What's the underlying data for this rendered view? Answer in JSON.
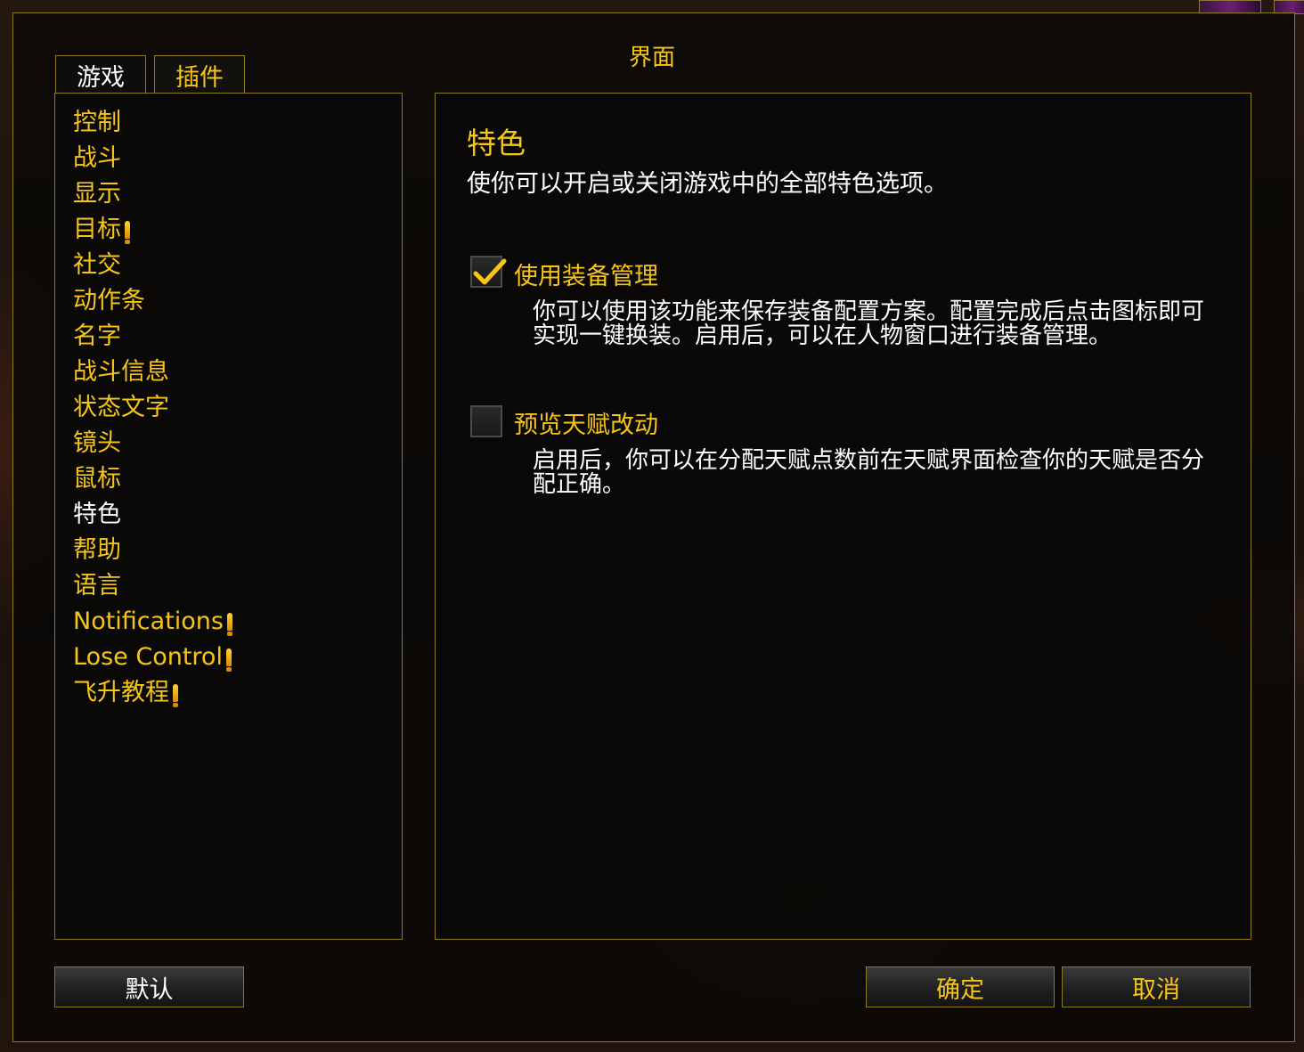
{
  "window": {
    "title": "界面"
  },
  "tabs": [
    {
      "label": "游戏",
      "active": true
    },
    {
      "label": "插件",
      "active": false
    }
  ],
  "categories": [
    {
      "label": "控制",
      "alert": false
    },
    {
      "label": "战斗",
      "alert": false
    },
    {
      "label": "显示",
      "alert": false
    },
    {
      "label": "目标",
      "alert": true
    },
    {
      "label": "社交",
      "alert": false
    },
    {
      "label": "动作条",
      "alert": false
    },
    {
      "label": "名字",
      "alert": false
    },
    {
      "label": "战斗信息",
      "alert": false
    },
    {
      "label": "状态文字",
      "alert": false
    },
    {
      "label": "镜头",
      "alert": false
    },
    {
      "label": "鼠标",
      "alert": false
    },
    {
      "label": "特色",
      "alert": false,
      "selected": true
    },
    {
      "label": "帮助",
      "alert": false
    },
    {
      "label": "语言",
      "alert": false
    },
    {
      "label": "Notifications",
      "alert": true
    },
    {
      "label": "Lose Control",
      "alert": true
    },
    {
      "label": "飞升教程",
      "alert": true
    }
  ],
  "section": {
    "title": "特色",
    "description": "使你可以开启或关闭游戏中的全部特色选项。"
  },
  "options": [
    {
      "label": "使用装备管理",
      "checked": true,
      "description": "你可以使用该功能来保存装备配置方案。配置完成后点击图标即可实现一键换装。启用后，可以在人物窗口进行装备管理。"
    },
    {
      "label": "预览天赋改动",
      "checked": false,
      "description": "启用后，你可以在分配天赋点数前在天赋界面检查你的天赋是否分配正确。"
    }
  ],
  "buttons": {
    "defaults": "默认",
    "okay": "确定",
    "cancel": "取消"
  },
  "colors": {
    "accent_gold": "#f5c518",
    "border_gold": "#8c7a1e",
    "selected_highlight": "#3c5096"
  }
}
